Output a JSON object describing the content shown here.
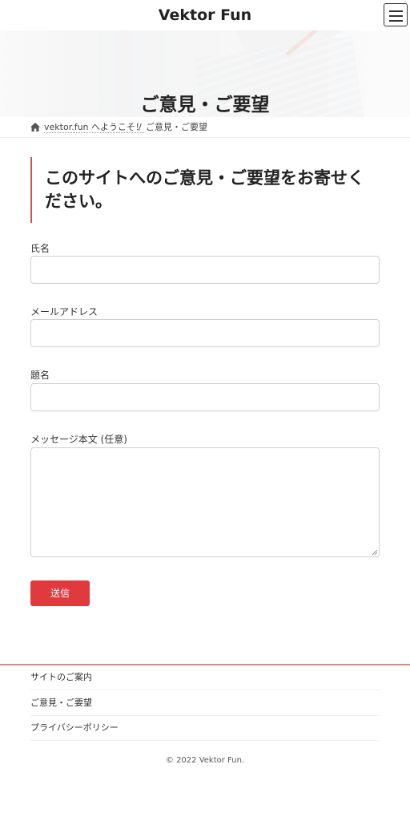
{
  "header": {
    "site_title": "Vektor Fun",
    "menu_icon": "hamburger-menu-icon"
  },
  "hero": {
    "title": "ご意見・ご要望"
  },
  "breadcrumb": {
    "home_icon": "home-icon",
    "home_label": "vektor.fun へようこそ！",
    "separator": "/",
    "current": "ご意見・ご要望"
  },
  "main": {
    "heading_line1": "このサイトへのご意見・ご要望をお寄せく",
    "heading_line2": "ださい。",
    "form": {
      "name_label": "氏名",
      "name_value": "",
      "email_label": "メールアドレス",
      "email_value": "",
      "subject_label": "題名",
      "subject_value": "",
      "message_label": "メッセージ本文 (任意)",
      "message_value": "",
      "submit_label": "送信"
    }
  },
  "footer": {
    "nav": [
      "サイトのご案内",
      "ご意見・ご要望",
      "プライバシーポリシー"
    ],
    "copyright": "© 2022 Vektor Fun."
  },
  "colors": {
    "accent_red": "#e03a3e",
    "heading_border": "#c8584a",
    "footer_line": "#d98a80"
  }
}
